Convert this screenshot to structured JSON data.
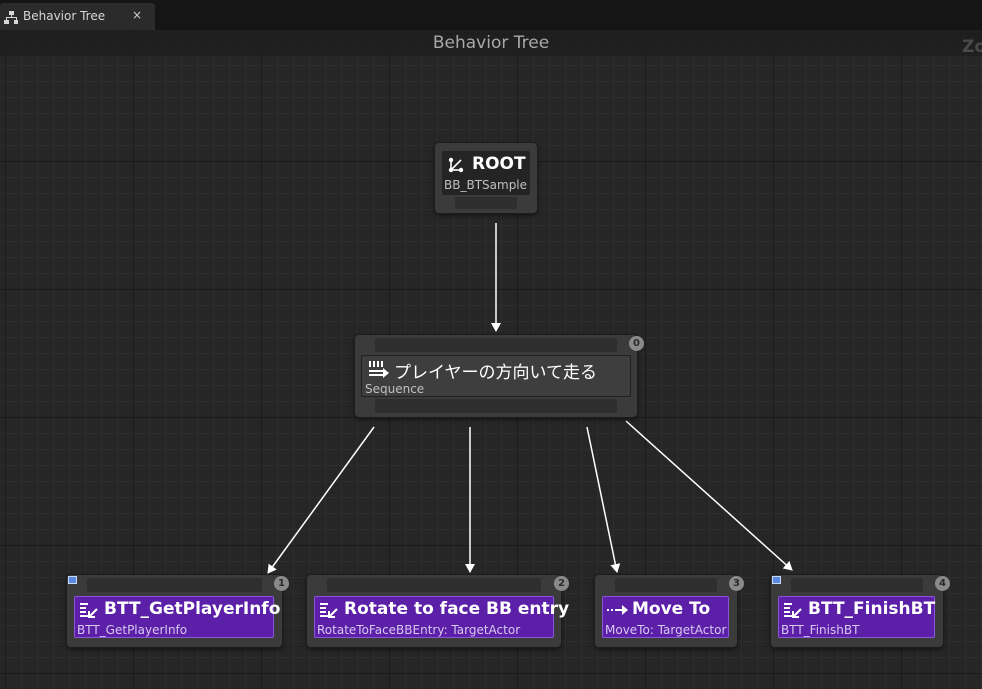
{
  "tab": {
    "label": "Behavior Tree",
    "icon": "behavior-tree-icon",
    "close": "×"
  },
  "graph": {
    "title": "Behavior Tree",
    "zoom": "Zo"
  },
  "root": {
    "title": "ROOT",
    "subtitle": "BB_BTSample",
    "icon": "root-branch-icon"
  },
  "sequence": {
    "title": "プレイヤーの方向いて走る",
    "subtitle": "Sequence",
    "index": "0",
    "icon": "sequence-icon"
  },
  "tasks": [
    {
      "title": "BTT_GetPlayerInfo",
      "subtitle": "BTT_GetPlayerInfo",
      "index": "1",
      "icon": "task-icon"
    },
    {
      "title": "Rotate to face BB entry",
      "subtitle": "RotateToFaceBBEntry: TargetActor",
      "index": "2",
      "icon": "task-icon"
    },
    {
      "title": "Move To",
      "subtitle": "MoveTo: TargetActor",
      "index": "3",
      "icon": "move-to-icon"
    },
    {
      "title": "BTT_FinishBT",
      "subtitle": "BTT_FinishBT",
      "index": "4",
      "icon": "task-icon"
    }
  ],
  "colors": {
    "task": "#5b1fa8",
    "wire": "#ffffff",
    "background": "#262626"
  }
}
